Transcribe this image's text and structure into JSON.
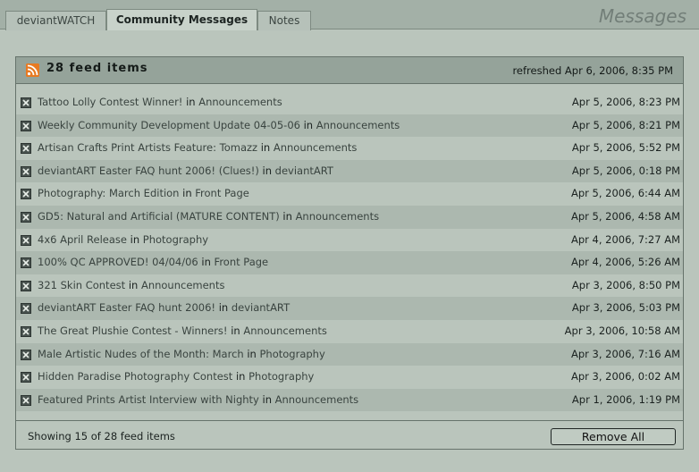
{
  "tabs": [
    {
      "label": "deviantWATCH",
      "active": false
    },
    {
      "label": "Community Messages",
      "active": true
    },
    {
      "label": "Notes",
      "active": false
    }
  ],
  "section_title": "Messages",
  "panel": {
    "icon": "rss-feed-icon",
    "feed_count": "28 feed items",
    "refreshed": "refreshed Apr 6, 2006, 8:35 PM"
  },
  "in_word": "in",
  "items": [
    {
      "title": "Tattoo Lolly Contest Winner!",
      "category": "Announcements",
      "date": "Apr 5, 2006, 8:23 PM"
    },
    {
      "title": "Weekly Community Development Update 04-05-06",
      "category": "Announcements",
      "date": "Apr 5, 2006, 8:21 PM"
    },
    {
      "title": "Artisan Crafts Print Artists Feature: Tomazz",
      "category": "Announcements",
      "date": "Apr 5, 2006, 5:52 PM"
    },
    {
      "title": "deviantART Easter FAQ hunt 2006! (Clues!)",
      "category": "deviantART",
      "date": "Apr 5, 2006, 0:18 PM"
    },
    {
      "title": "Photography: March Edition",
      "category": "Front Page",
      "date": "Apr 5, 2006, 6:44 AM"
    },
    {
      "title": "GD5: Natural and Artificial (MATURE CONTENT)",
      "category": "Announcements",
      "date": "Apr 5, 2006, 4:58 AM"
    },
    {
      "title": "4x6 April Release",
      "category": "Photography",
      "date": "Apr 4, 2006, 7:27 AM"
    },
    {
      "title": "100% QC APPROVED! 04/04/06",
      "category": "Front Page",
      "date": "Apr 4, 2006, 5:26 AM"
    },
    {
      "title": "321 Skin Contest",
      "category": "Announcements",
      "date": "Apr 3, 2006, 8:50 PM"
    },
    {
      "title": "deviantART Easter FAQ hunt 2006!",
      "category": "deviantART",
      "date": "Apr 3, 2006, 5:03 PM"
    },
    {
      "title": "The Great Plushie Contest - Winners!",
      "category": "Announcements",
      "date": "Apr 3, 2006, 10:58 AM"
    },
    {
      "title": "Male Artistic Nudes of the Month: March",
      "category": "Photography",
      "date": "Apr 3, 2006, 7:16 AM"
    },
    {
      "title": "Hidden Paradise Photography Contest",
      "category": "Photography",
      "date": "Apr 3, 2006, 0:02 AM"
    },
    {
      "title": "Featured Prints Artist Interview with Nighty",
      "category": "Announcements",
      "date": "Apr 1, 2006, 1:19 PM"
    }
  ],
  "footer": {
    "showing": "Showing 15 of 28 feed items",
    "remove_all": "Remove All"
  },
  "colors": {
    "background": "#bac5bc",
    "header": "#95a39a",
    "alt_row": "#acb8af",
    "rss": "#e77a22"
  }
}
